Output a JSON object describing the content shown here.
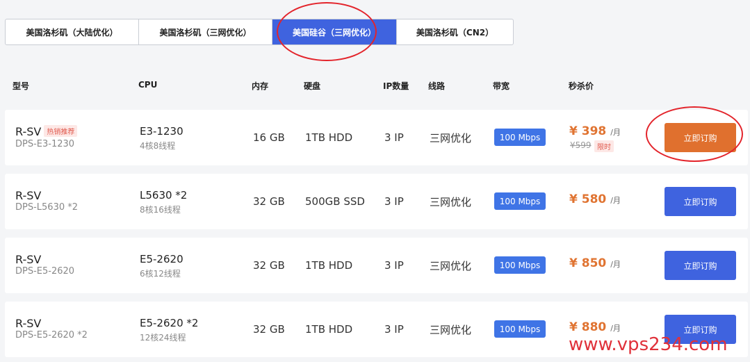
{
  "tabs": [
    {
      "label": "美国洛杉矶（大陆优化）",
      "active": false
    },
    {
      "label": "美国洛杉矶（三网优化）",
      "active": false
    },
    {
      "label": "美国硅谷（三网优化）",
      "active": true
    },
    {
      "label": "美国洛杉矶（CN2）",
      "active": false
    }
  ],
  "columns": {
    "model": "型号",
    "cpu": "CPU",
    "memory": "内存",
    "disk": "硬盘",
    "ip": "IP数量",
    "line": "线路",
    "bandwidth": "带宽",
    "price": "秒杀价"
  },
  "rows": [
    {
      "model": "R-SV",
      "badge": "热销推荐",
      "sku": "DPS-E3-1230",
      "cpu": "E3-1230",
      "cores": "4核8线程",
      "memory": "16 GB",
      "disk": "1TB HDD",
      "ip": "3 IP",
      "line": "三网优化",
      "bandwidth": "100 Mbps",
      "price": "¥ 398",
      "unit": "/月",
      "old_price": "¥599",
      "limit": "限时",
      "button": "立即订购"
    },
    {
      "model": "R-SV",
      "sku": "DPS-L5630 *2",
      "cpu": "L5630 *2",
      "cores": "8核16线程",
      "memory": "32 GB",
      "disk": "500GB SSD",
      "ip": "3 IP",
      "line": "三网优化",
      "bandwidth": "100 Mbps",
      "price": "¥ 580",
      "unit": "/月",
      "button": "立即订购"
    },
    {
      "model": "R-SV",
      "sku": "DPS-E5-2620",
      "cpu": "E5-2620",
      "cores": "6核12线程",
      "memory": "32 GB",
      "disk": "1TB HDD",
      "ip": "3 IP",
      "line": "三网优化",
      "bandwidth": "100 Mbps",
      "price": "¥ 850",
      "unit": "/月",
      "button": "立即订购"
    },
    {
      "model": "R-SV",
      "sku": "DPS-E5-2620 *2",
      "cpu": "E5-2620 *2",
      "cores": "12核24线程",
      "memory": "32 GB",
      "disk": "1TB HDD",
      "ip": "3 IP",
      "line": "三网优化",
      "bandwidth": "100 Mbps",
      "price": "¥ 880",
      "unit": "/月",
      "button": "立即订购"
    }
  ],
  "watermark": "www.vps234.com",
  "colors": {
    "accent": "#3f63df",
    "highlight_button": "#e0702e",
    "price": "#e07432",
    "annotation": "#e3242b"
  }
}
